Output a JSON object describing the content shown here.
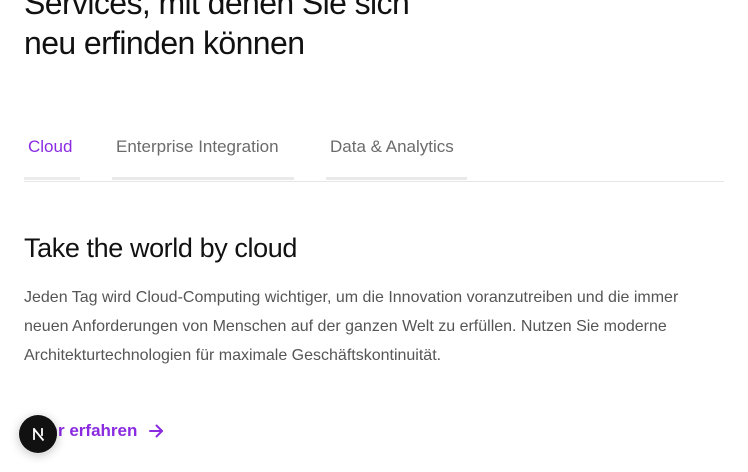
{
  "section": {
    "heading_line1": "Services, mit denen Sie sich",
    "heading_line2": "neu erfinden können"
  },
  "tabs": [
    {
      "label": "Cloud",
      "active": true
    },
    {
      "label": "Enterprise Integration",
      "active": false
    },
    {
      "label": "Data & Analytics",
      "active": false
    }
  ],
  "panel": {
    "title": "Take the world by cloud",
    "text": "Jeden Tag wird Cloud-Computing wichtiger, um die Innovation voranzutreiben und die immer neuen Anforderungen von Menschen auf der ganzen Welt zu erfüllen. Nutzen Sie moderne Architekturtechnologien für maximale Geschäftskontinuität.",
    "cta_label": "Mehr erfahren"
  },
  "colors": {
    "accent": "#8a2be2",
    "text": "#111111",
    "muted": "#6b6b6b",
    "body_text": "#555555",
    "badge": "#111111"
  },
  "icons": {
    "cta": "arrow-right-icon",
    "badge": "nextjs-logo-icon"
  }
}
